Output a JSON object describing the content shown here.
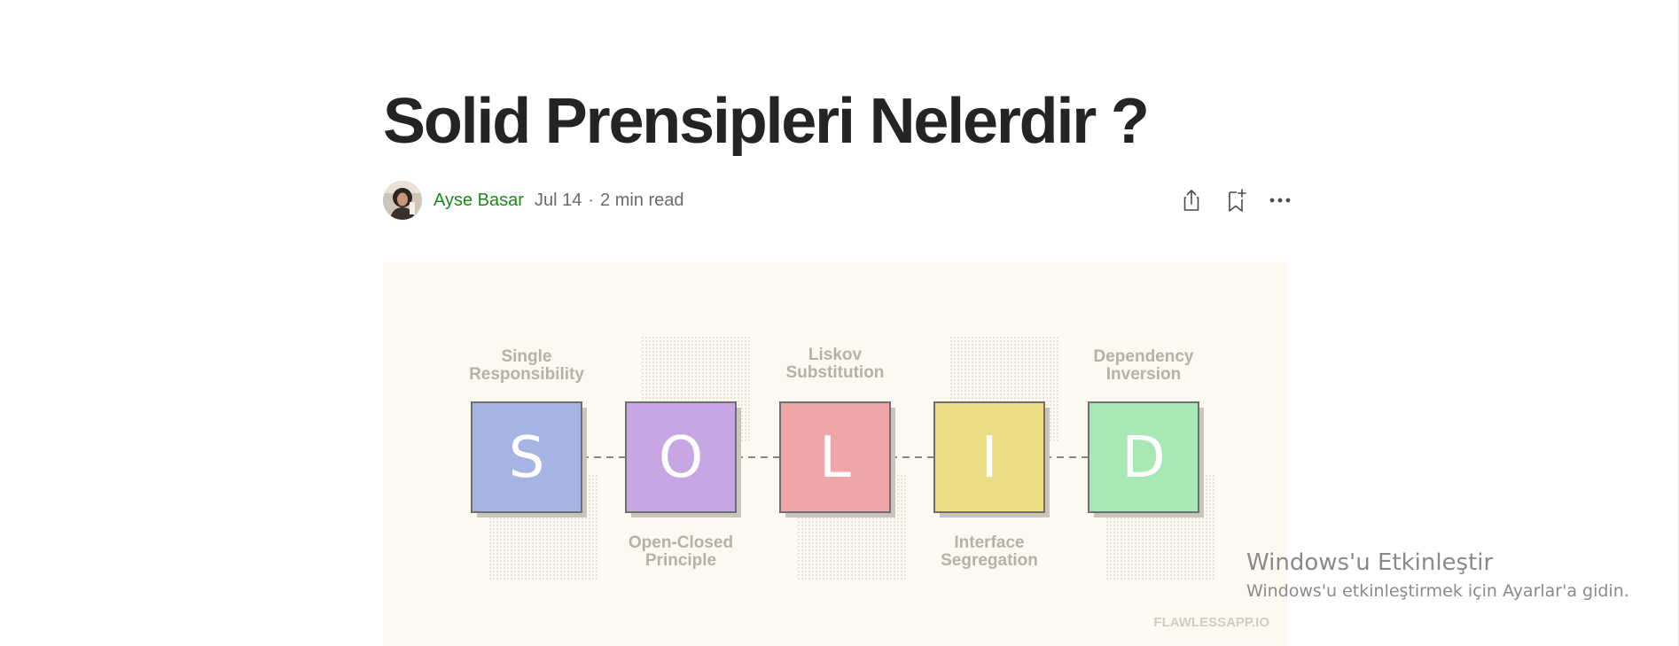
{
  "article": {
    "title": "Solid Prensipleri Nelerdir ?",
    "author": "Ayse Basar",
    "date": "Jul 14",
    "separator": "·",
    "read_time": "2 min read",
    "actions": [
      {
        "name": "share-icon"
      },
      {
        "name": "bookmark-add-icon"
      },
      {
        "name": "more-options-icon"
      }
    ]
  },
  "hero_image": {
    "blocks": [
      {
        "letter": "S",
        "label_line1": "Single",
        "label_line2": "Responsibility",
        "color": "#a6b4e4"
      },
      {
        "letter": "O",
        "label_line1": "Open-Closed",
        "label_line2": "Principle",
        "color": "#c6a7e4"
      },
      {
        "letter": "L",
        "label_line1": "Liskov",
        "label_line2": "Substitution",
        "color": "#f0a6a8"
      },
      {
        "letter": "I",
        "label_line1": "Interface",
        "label_line2": "Segregation",
        "color": "#ecdc84"
      },
      {
        "letter": "D",
        "label_line1": "Dependency",
        "label_line2": "Inversion",
        "color": "#a8e8b6"
      }
    ],
    "credit": "FLAWLESSAPP.IO"
  },
  "os_watermark": {
    "title": "Windows'u Etkinleştir",
    "subtitle": "Windows'u etkinleştirmek için Ayarlar'a gidin."
  },
  "colors": {
    "text": "#242424",
    "author": "#1a8917",
    "muted": "#6b6b6b",
    "hero_bg": "#fcf9f0"
  }
}
